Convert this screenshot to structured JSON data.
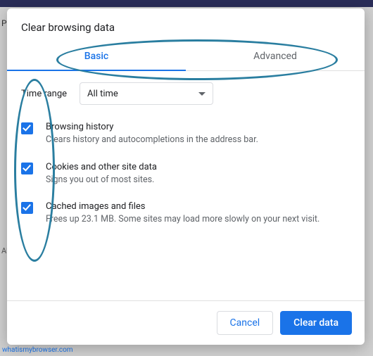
{
  "backdrop": {
    "peek_text": "Pe",
    "autofill_label": "AU",
    "footer_link": "whatismybrowser.com"
  },
  "dialog": {
    "title": "Clear browsing data",
    "tabs": {
      "basic": "Basic",
      "advanced": "Advanced"
    },
    "time_range": {
      "label": "Time range",
      "selected": "All time"
    },
    "options": [
      {
        "title": "Browsing history",
        "desc": "Clears history and autocompletions in the address bar."
      },
      {
        "title": "Cookies and other site data",
        "desc": "Signs you out of most sites."
      },
      {
        "title": "Cached images and files",
        "desc": "Frees up 23.1 MB. Some sites may load more slowly on your next visit."
      }
    ],
    "actions": {
      "cancel": "Cancel",
      "confirm": "Clear data"
    }
  }
}
